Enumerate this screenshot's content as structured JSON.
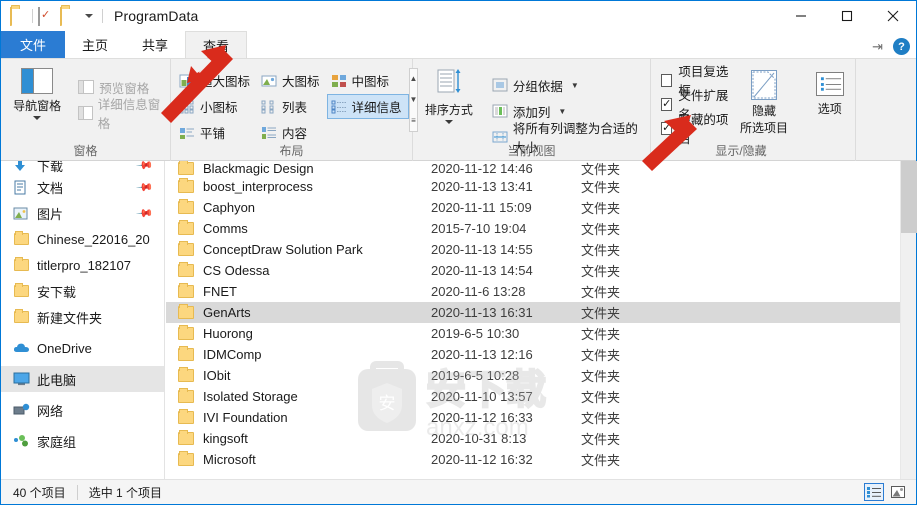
{
  "window": {
    "title": "ProgramData",
    "quick_access": [
      "folder-icon",
      "properties-icon",
      "new-folder-icon",
      "dropdown-caret"
    ],
    "minimize": "—",
    "maximize": "☐",
    "close": "✕",
    "pin_ribbon": "pin-icon",
    "help": "?"
  },
  "tabs": [
    {
      "label": "文件",
      "name": "tab-file"
    },
    {
      "label": "主页",
      "name": "tab-home"
    },
    {
      "label": "共享",
      "name": "tab-share"
    },
    {
      "label": "查看",
      "name": "tab-view"
    }
  ],
  "ribbon": {
    "groups": [
      {
        "label": "窗格"
      },
      {
        "label": "布局"
      },
      {
        "label": "当前视图"
      },
      {
        "label": "显示/隐藏"
      }
    ],
    "panes": {
      "nav_pane": "导航窗格",
      "preview_pane": "预览窗格",
      "details_pane": "详细信息窗格"
    },
    "layout": {
      "items": [
        "超大图标",
        "大图标",
        "中图标",
        "小图标",
        "列表",
        "详细信息",
        "平铺",
        "内容"
      ],
      "selected": "详细信息"
    },
    "current_view": {
      "sort_by": "排序方式",
      "group_by": "分组依据",
      "add_columns": "添加列",
      "size_columns": "将所有列调整为合适的大小"
    },
    "show_hide": {
      "item_checkboxes": {
        "label": "项目复选框",
        "checked": false
      },
      "file_extensions": {
        "label": "文件扩展名",
        "checked": true
      },
      "hidden_items": {
        "label": "隐藏的项目",
        "checked": true
      },
      "hide_selected": {
        "line1": "隐藏",
        "line2": "所选项目"
      },
      "options": "选项"
    }
  },
  "sidebar": {
    "items": [
      {
        "label": "下载",
        "icon": "download-icon",
        "pinned": true,
        "selected": false
      },
      {
        "label": "文档",
        "icon": "document-icon",
        "pinned": true,
        "selected": false
      },
      {
        "label": "图片",
        "icon": "picture-icon",
        "pinned": true,
        "selected": false
      },
      {
        "label": "Chinese_22016_20",
        "icon": "folder-icon",
        "pinned": false,
        "selected": false
      },
      {
        "label": "titlerpro_182107",
        "icon": "folder-icon",
        "pinned": false,
        "selected": false
      },
      {
        "label": "安下载",
        "icon": "folder-icon",
        "pinned": false,
        "selected": false
      },
      {
        "label": "新建文件夹",
        "icon": "folder-icon",
        "pinned": false,
        "selected": false
      },
      {
        "label": "OneDrive",
        "icon": "cloud-icon",
        "pinned": false,
        "selected": false
      },
      {
        "label": "此电脑",
        "icon": "this-pc-icon",
        "pinned": false,
        "selected": true
      },
      {
        "label": "网络",
        "icon": "network-icon",
        "pinned": false,
        "selected": false
      },
      {
        "label": "家庭组",
        "icon": "homegroup-icon",
        "pinned": false,
        "selected": false
      }
    ]
  },
  "filelist": {
    "rows": [
      {
        "name": "Blackmagic Design",
        "date": "2020-11-12 14:46",
        "type": "文件夹",
        "selected": false
      },
      {
        "name": "boost_interprocess",
        "date": "2020-11-13 13:41",
        "type": "文件夹",
        "selected": false
      },
      {
        "name": "Caphyon",
        "date": "2020-11-11 15:09",
        "type": "文件夹",
        "selected": false
      },
      {
        "name": "Comms",
        "date": "2015-7-10 19:04",
        "type": "文件夹",
        "selected": false
      },
      {
        "name": "ConceptDraw Solution Park",
        "date": "2020-11-13 14:55",
        "type": "文件夹",
        "selected": false
      },
      {
        "name": "CS Odessa",
        "date": "2020-11-13 14:54",
        "type": "文件夹",
        "selected": false
      },
      {
        "name": "FNET",
        "date": "2020-11-6 13:28",
        "type": "文件夹",
        "selected": false
      },
      {
        "name": "GenArts",
        "date": "2020-11-13 16:31",
        "type": "文件夹",
        "selected": true
      },
      {
        "name": "Huorong",
        "date": "2019-6-5 10:30",
        "type": "文件夹",
        "selected": false
      },
      {
        "name": "IDMComp",
        "date": "2020-11-13 12:16",
        "type": "文件夹",
        "selected": false
      },
      {
        "name": "IObit",
        "date": "2019-6-5 10:28",
        "type": "文件夹",
        "selected": false
      },
      {
        "name": "Isolated Storage",
        "date": "2020-11-10 13:57",
        "type": "文件夹",
        "selected": false
      },
      {
        "name": "IVI Foundation",
        "date": "2020-11-12 16:33",
        "type": "文件夹",
        "selected": false
      },
      {
        "name": "kingsoft",
        "date": "2020-10-31 8:13",
        "type": "文件夹",
        "selected": false
      },
      {
        "name": "Microsoft",
        "date": "2020-11-12 16:32",
        "type": "文件夹",
        "selected": false
      }
    ]
  },
  "watermark": {
    "logo_text": "安",
    "title": "安下载",
    "url": "anxz.com"
  },
  "statusbar": {
    "item_count": "40 个项目",
    "selected_count": "选中 1 个项目",
    "view_details": "details-view-icon",
    "view_large": "large-icons-view-icon"
  },
  "annotations": {
    "arrow_color": "#d92b1c",
    "arrow1_target": "查看",
    "arrow2_target": "隐藏的项目"
  }
}
